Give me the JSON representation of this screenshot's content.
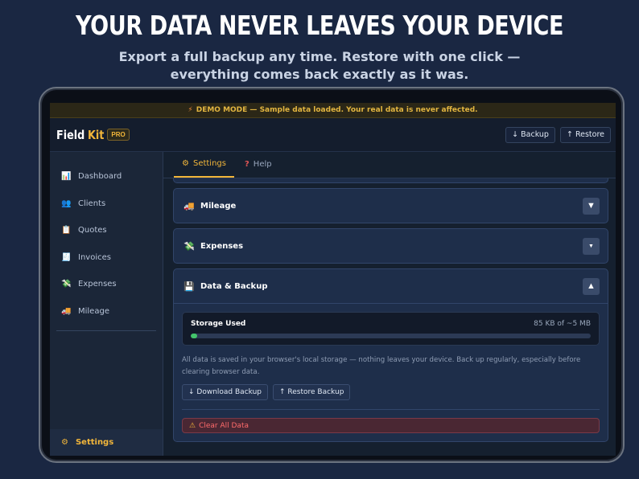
{
  "hero": {
    "headline": "YOUR DATA NEVER LEAVES YOUR DEVICE",
    "sub_line1": "Export a full backup any time. Restore with one click —",
    "sub_line2": "everything comes back exactly as it was."
  },
  "banner": {
    "icon": "lightning-icon",
    "text": "DEMO MODE — Sample data loaded. Your real data is never affected."
  },
  "header": {
    "brand_field": "Field",
    "brand_kit": "Kit",
    "badge": "PRO",
    "backup_label": "↓ Backup",
    "restore_label": "↑ Restore"
  },
  "sidebar": {
    "items": [
      {
        "label": "Dashboard",
        "icon": "chart-icon",
        "glyph": "📊"
      },
      {
        "label": "Clients",
        "icon": "people-icon",
        "glyph": "👥"
      },
      {
        "label": "Quotes",
        "icon": "clipboard-icon",
        "glyph": "📋"
      },
      {
        "label": "Invoices",
        "icon": "receipt-icon",
        "glyph": "🧾"
      },
      {
        "label": "Expenses",
        "icon": "money-icon",
        "glyph": "💸"
      },
      {
        "label": "Mileage",
        "icon": "truck-icon",
        "glyph": "🚚"
      }
    ],
    "settings": {
      "label": "Settings",
      "icon": "gear-icon",
      "glyph": "⚙"
    }
  },
  "tabs": [
    {
      "label": "Settings",
      "glyph": "⚙",
      "icon": "gear-icon"
    },
    {
      "label": "Help",
      "glyph": "?",
      "icon": "question-icon"
    }
  ],
  "sections": {
    "mileage": {
      "title": "Mileage",
      "glyph": "🚚",
      "toggle": "▼"
    },
    "expenses": {
      "title": "Expenses",
      "glyph": "💸",
      "toggle": "▼"
    },
    "backup": {
      "title": "Data & Backup",
      "glyph": "💾",
      "toggle": "▲"
    }
  },
  "storage": {
    "label": "Storage Used",
    "value": "85 KB of ~5 MB",
    "fraction": 0.017
  },
  "backup": {
    "description": "All data is saved in your browser's local storage — nothing leaves your device. Back up regularly, especially before clearing browser data.",
    "download_label": "↓ Download Backup",
    "restore_label": "↑ Restore Backup",
    "clear_label": "Clear All Data",
    "clear_glyph": "⚠"
  },
  "colors": {
    "accent": "#f2b63a",
    "danger": "#ff6b6b",
    "storage_bar": "#43c46b"
  }
}
